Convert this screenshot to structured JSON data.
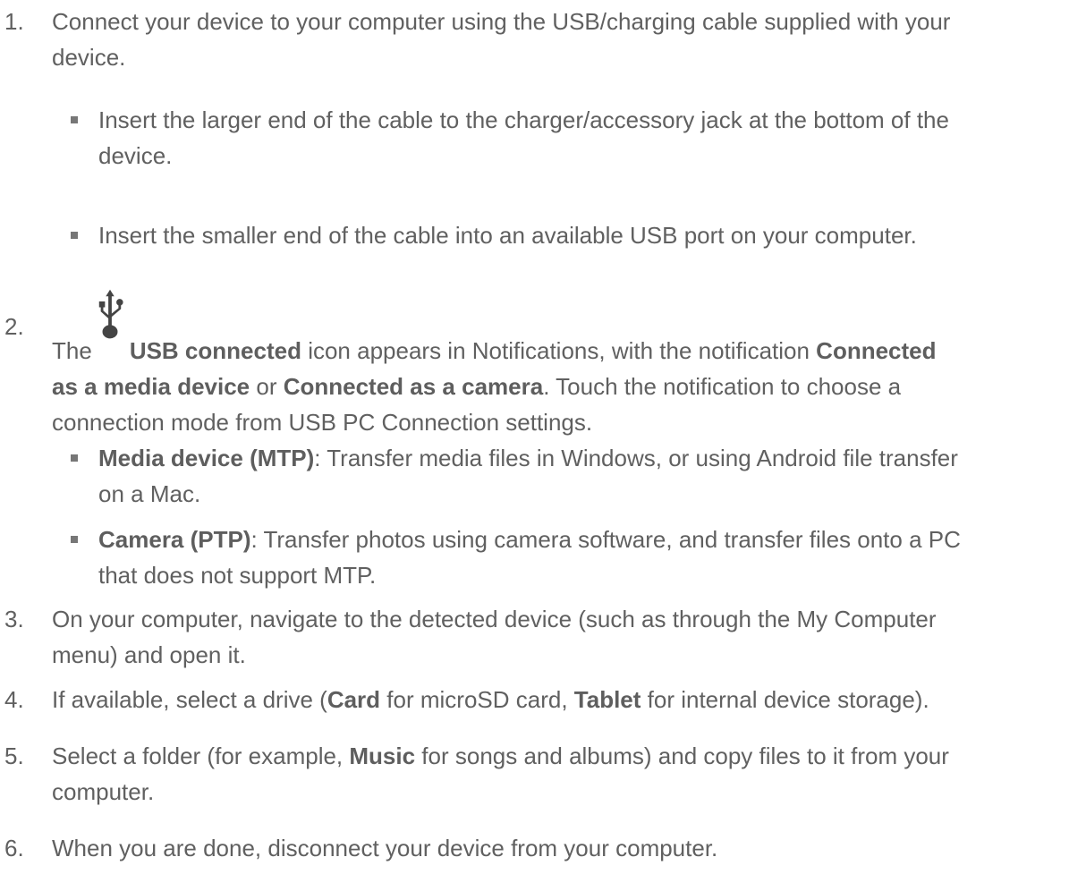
{
  "steps": [
    {
      "number": "1.",
      "line1": "Connect your device to your computer using the USB/charging cable supplied with your",
      "line2": "device.",
      "subitems": [
        {
          "line1": "Insert the larger end of the cable to the charger/accessory jack at the bottom of the",
          "line2": "device."
        },
        {
          "line1": "Insert the smaller end of the cable into an available USB port on your computer."
        }
      ]
    },
    {
      "number": "2.",
      "pre": "The",
      "icon": "usb-icon",
      "b1": "USB connected",
      "t1": " icon appears in Notifications, with the notification ",
      "b2": "Connected",
      "b3": "as a media device",
      "t2": " or ",
      "b4": "Connected as a camera",
      "t3": ". Touch the notification to choose a",
      "line3": "connection mode from USB PC Connection settings.",
      "subitems": [
        {
          "bold": "Media device (MTP)",
          "line1": ": Transfer media files in Windows, or using Android file transfer",
          "line2": "on a Mac."
        },
        {
          "bold": "Camera (PTP)",
          "line1": ": Transfer photos using camera software, and transfer files onto a PC",
          "line2": "that does not support MTP."
        }
      ]
    },
    {
      "number": "3.",
      "line1": "On your computer, navigate to the detected device (such as through the My Computer",
      "line2": "menu) and open it."
    },
    {
      "number": "4.",
      "t1": "If available, select a drive (",
      "b1": "Card",
      "t2": " for microSD card, ",
      "b2": "Tablet",
      "t3": " for internal device storage)."
    },
    {
      "number": "5.",
      "t1": "Select a folder (for example, ",
      "b1": "Music",
      "t2": " for songs and albums) and copy files to it from your",
      "line2": "computer."
    },
    {
      "number": "6.",
      "line1": "When you are done, disconnect your device from your computer."
    }
  ]
}
